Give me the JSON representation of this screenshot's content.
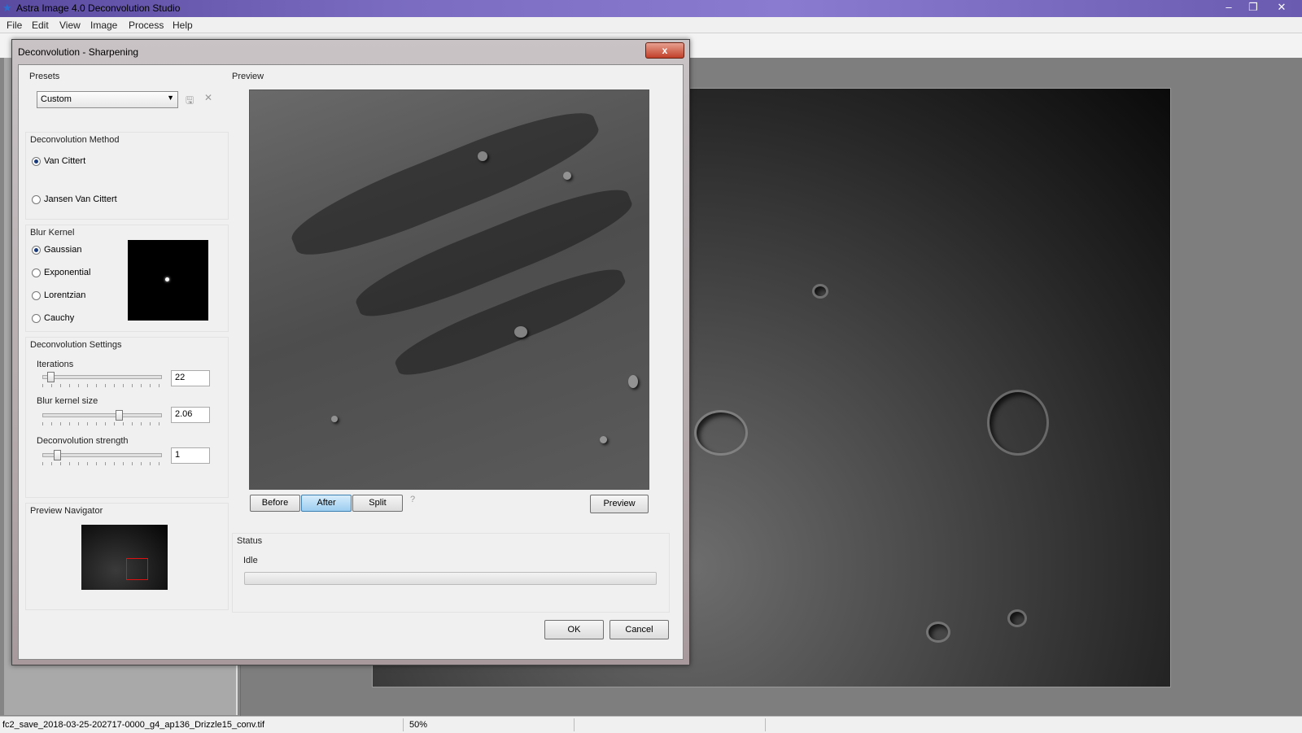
{
  "app": {
    "title": "Astra Image 4.0 Deconvolution Studio",
    "app_icon": "star-icon",
    "window_controls": [
      "minimize",
      "maximize",
      "close"
    ]
  },
  "menu": [
    "File",
    "Edit",
    "View",
    "Image",
    "Process",
    "Help"
  ],
  "statusbar": {
    "filename": "fc2_save_2018-03-25-202717-0000_g4_ap136_Drizzle15_conv.tif",
    "zoom": "50%"
  },
  "dialog": {
    "title": "Deconvolution - Sharpening",
    "close_label": "x",
    "presets": {
      "label": "Presets",
      "selected": "Custom",
      "save_icon": "save-icon",
      "delete_icon": "delete-icon"
    },
    "method": {
      "label": "Deconvolution Method",
      "options": [
        "Van Cittert",
        "Jansen Van Cittert"
      ],
      "selected_index": 0
    },
    "kernel": {
      "label": "Blur Kernel",
      "options": [
        "Gaussian",
        "Exponential",
        "Lorentzian",
        "Cauchy"
      ],
      "selected_index": 0
    },
    "settings": {
      "label": "Deconvolution Settings",
      "iterations": {
        "label": "Iterations",
        "value": "22",
        "position": 0.04
      },
      "kernel_size": {
        "label": "Blur kernel size",
        "value": "2.06",
        "position": 0.65
      },
      "strength": {
        "label": "Deconvolution strength",
        "value": "1",
        "position": 0.1
      }
    },
    "navigator": {
      "label": "Preview Navigator"
    },
    "preview": {
      "label": "Preview",
      "mode_buttons": [
        "Before",
        "After",
        "Split"
      ],
      "active_mode": "After",
      "help_icon": "help-icon",
      "preview_button": "Preview"
    },
    "status": {
      "label": "Status",
      "text": "Idle",
      "progress": 0
    },
    "ok_label": "OK",
    "cancel_label": "Cancel"
  }
}
